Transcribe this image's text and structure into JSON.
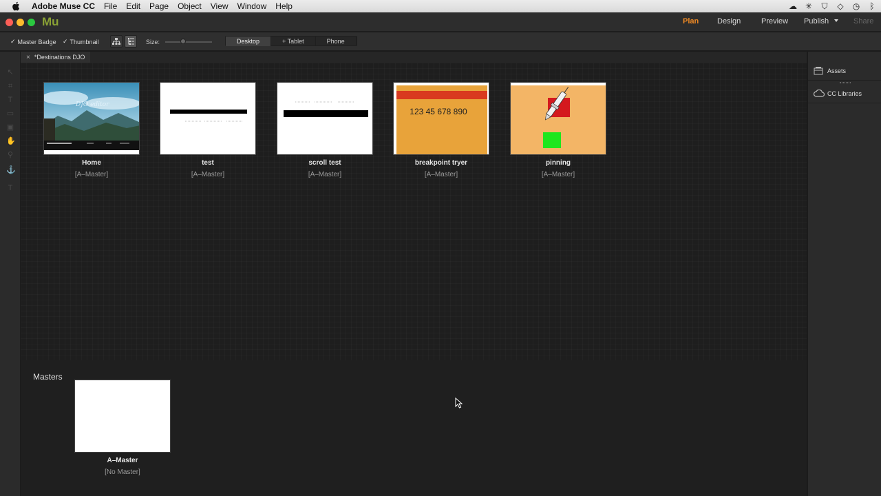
{
  "menubar": {
    "app_name": "Adobe Muse CC",
    "items": [
      "File",
      "Edit",
      "Page",
      "Object",
      "View",
      "Window",
      "Help"
    ]
  },
  "titlebar": {
    "logo": "Mu",
    "modes": {
      "plan": "Plan",
      "design": "Design",
      "preview": "Preview",
      "publish": "Publish",
      "share": "Share"
    }
  },
  "toolbar": {
    "master_badge": "Master Badge",
    "thumbnail": "Thumbnail",
    "size_label": "Size:",
    "breakpoints": [
      "Desktop",
      "+ Tablet",
      "Phone"
    ]
  },
  "doc_tab": {
    "title": "*Destinations DJO"
  },
  "pages": [
    {
      "name": "Home",
      "master": "[A–Master]"
    },
    {
      "name": "test",
      "master": "[A–Master]"
    },
    {
      "name": "scroll test",
      "master": "[A–Master]"
    },
    {
      "name": "breakpoint tryer",
      "master": "[A–Master]",
      "thumb_text": "123 45 678 890"
    },
    {
      "name": "pinning",
      "master": "[A–Master]"
    }
  ],
  "masters": {
    "label": "Masters",
    "items": [
      {
        "name": "A–Master",
        "master": "[No Master]"
      }
    ]
  },
  "right_panel": {
    "assets": "Assets",
    "cc_libraries": "CC Libraries"
  },
  "colors": {
    "accent": "#f08a24",
    "logo": "#8ba335",
    "thumb_orange": "#e8a33a",
    "thumb_red": "#d93a1f",
    "pin_bg": "#f3b566",
    "pin_green": "#1ee61e",
    "pin_red": "#d4191e"
  }
}
